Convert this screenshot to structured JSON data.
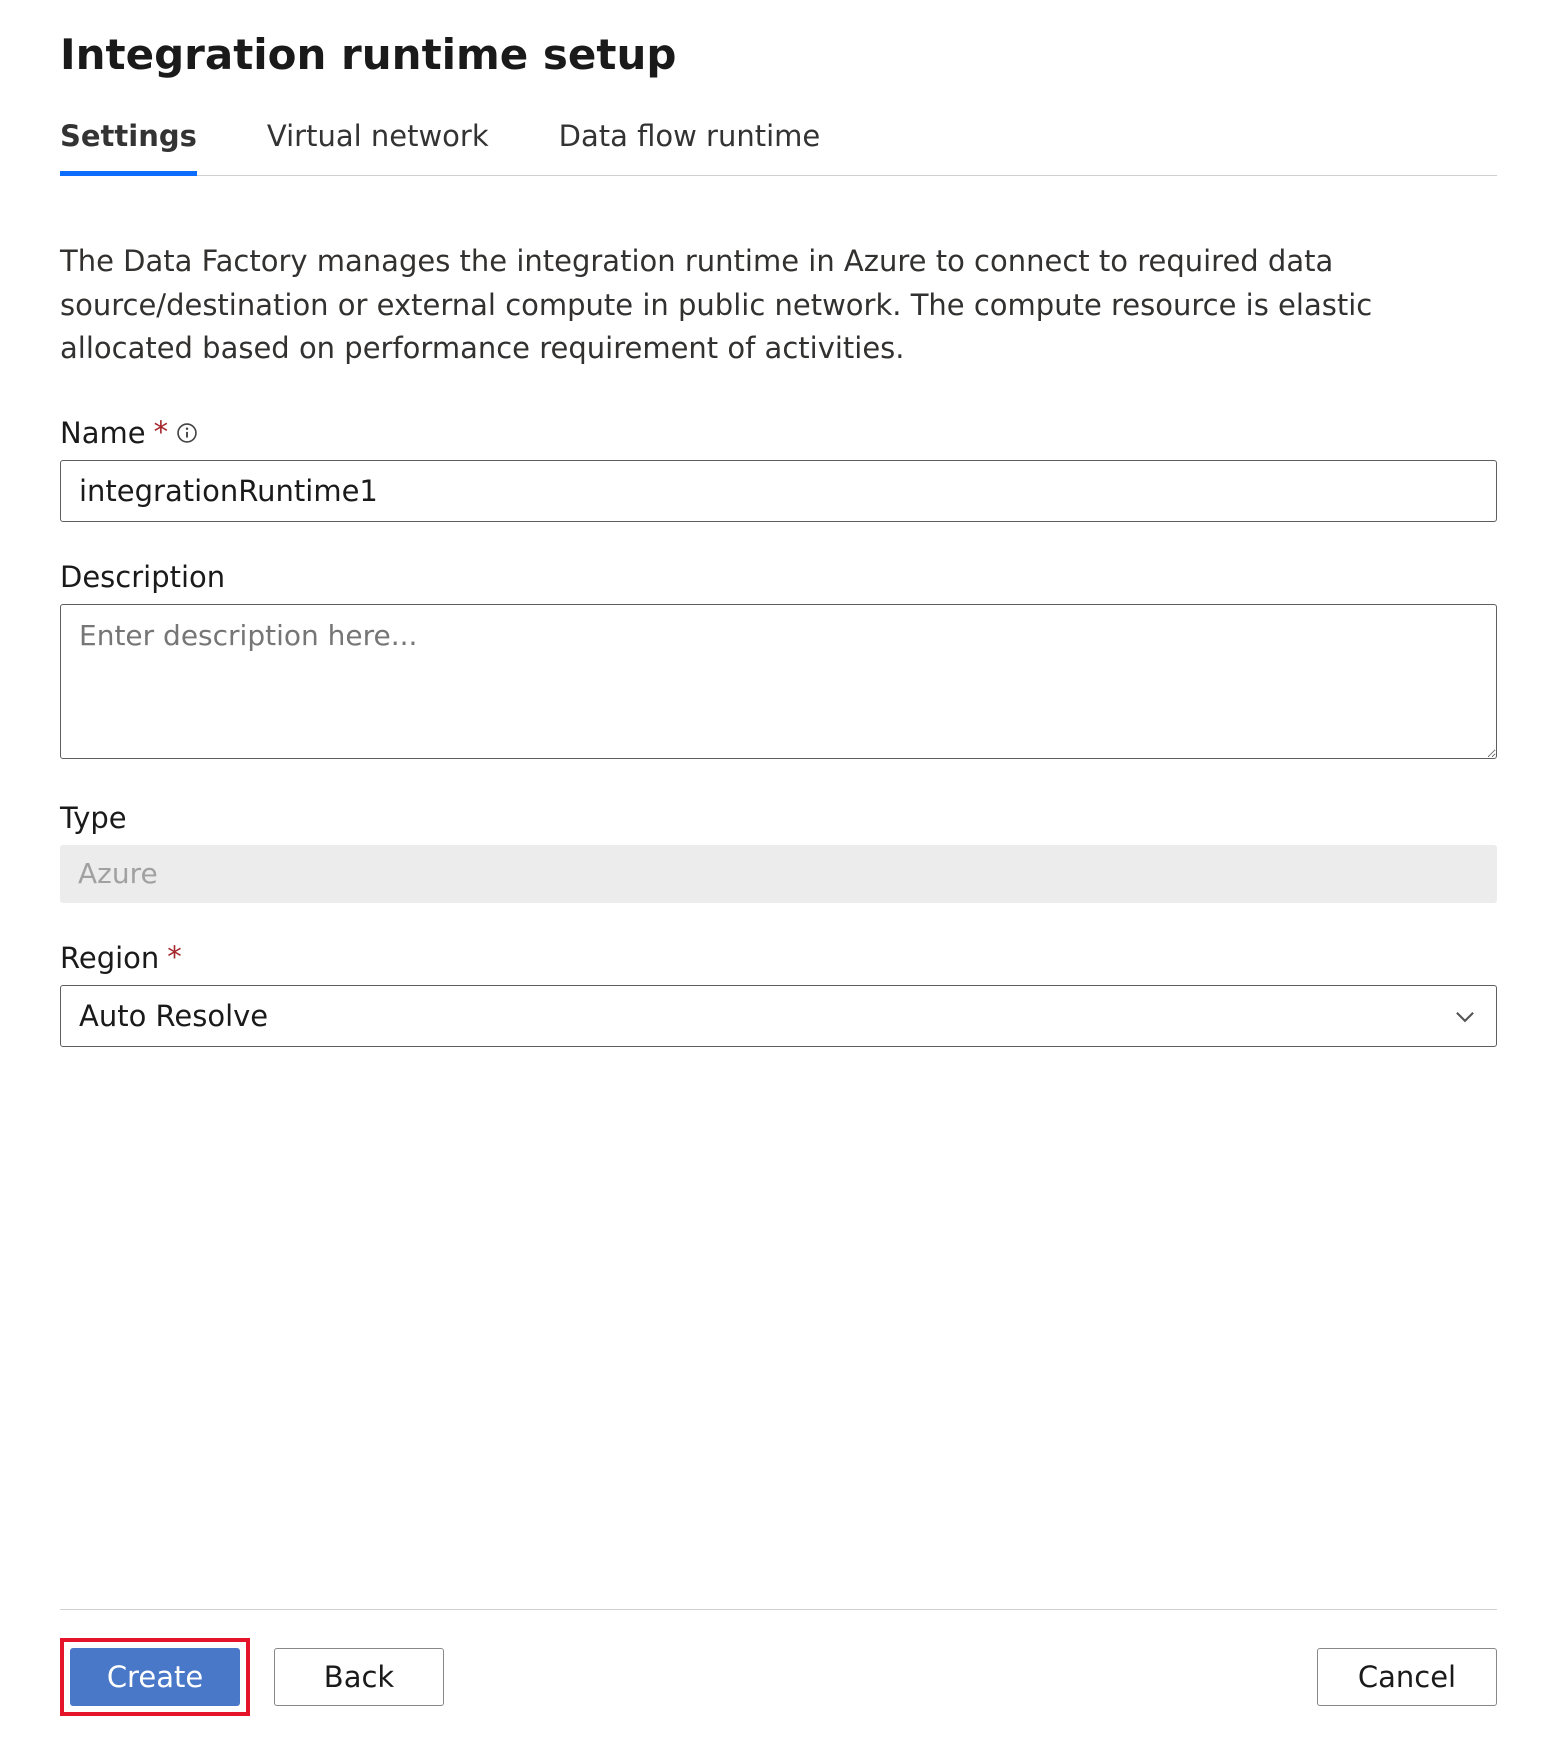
{
  "page": {
    "title": "Integration runtime setup",
    "description": "The Data Factory manages the integration runtime in Azure to connect to required data source/destination or external compute in public network. The compute resource is elastic allocated based on performance requirement of activities."
  },
  "tabs": [
    {
      "label": "Settings",
      "active": true
    },
    {
      "label": "Virtual network",
      "active": false
    },
    {
      "label": "Data flow runtime",
      "active": false
    }
  ],
  "fields": {
    "name": {
      "label": "Name",
      "required_marker": "*",
      "value": "integrationRuntime1"
    },
    "description": {
      "label": "Description",
      "placeholder": "Enter description here...",
      "value": ""
    },
    "type": {
      "label": "Type",
      "value": "Azure"
    },
    "region": {
      "label": "Region",
      "required_marker": "*",
      "selected": "Auto Resolve"
    }
  },
  "footer": {
    "create_label": "Create",
    "back_label": "Back",
    "cancel_label": "Cancel"
  }
}
